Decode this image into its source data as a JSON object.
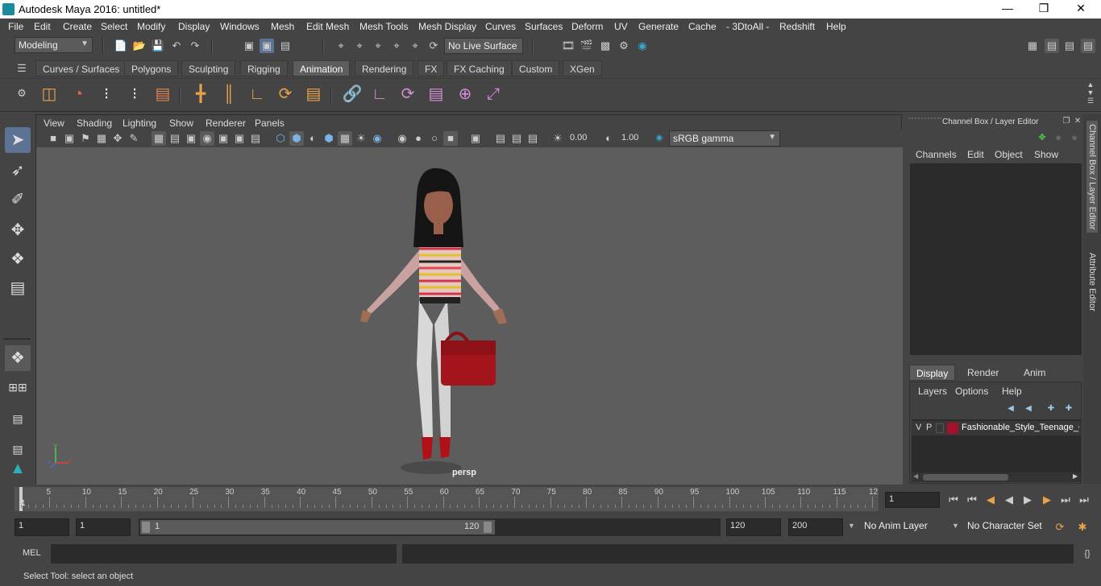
{
  "window": {
    "title": "Autodesk Maya 2016: untitled*"
  },
  "menus": [
    "File",
    "Edit",
    "Create",
    "Select",
    "Modify",
    "Display",
    "Windows",
    "Mesh",
    "Edit Mesh",
    "Mesh Tools",
    "Mesh Display",
    "Curves",
    "Surfaces",
    "Deform",
    "UV",
    "Generate",
    "Cache",
    "- 3DtoAll -",
    "Redshift",
    "Help"
  ],
  "status": {
    "mode": "Modeling",
    "live_surface": "No Live Surface"
  },
  "shelf_tabs": [
    "Curves / Surfaces",
    "Polygons",
    "Sculpting",
    "Rigging",
    "Animation",
    "Rendering",
    "FX",
    "FX Caching",
    "Custom",
    "XGen"
  ],
  "shelf_active": "Animation",
  "viewport": {
    "menus": [
      "View",
      "Shading",
      "Lighting",
      "Show",
      "Renderer",
      "Panels"
    ],
    "exposure": "0.00",
    "gamma": "1.00",
    "color_space": "sRGB gamma",
    "camera_label": "persp",
    "axis_y": "y",
    "axis_x": "x",
    "axis_z": "z"
  },
  "channel_box": {
    "title": "Channel Box / Layer Editor",
    "menus": [
      "Channels",
      "Edit",
      "Object",
      "Show"
    ]
  },
  "layer_editor": {
    "tabs": [
      "Display",
      "Render",
      "Anim"
    ],
    "menus": [
      "Layers",
      "Options",
      "Help"
    ],
    "layer": {
      "v": "V",
      "p": "P",
      "name": "Fashionable_Style_Teenage_Girl",
      "color": "#a3122a"
    }
  },
  "side_tabs": [
    "Channel Box / Layer Editor",
    "Attribute Editor"
  ],
  "timeline": {
    "ticks": [
      "5",
      "10",
      "15",
      "20",
      "25",
      "30",
      "35",
      "40",
      "45",
      "50",
      "55",
      "60",
      "65",
      "70",
      "75",
      "80",
      "85",
      "90",
      "95",
      "100",
      "105",
      "110",
      "115",
      "12"
    ],
    "start_label": "1",
    "current_frame": "1"
  },
  "range": {
    "start": "1",
    "playback_start": "1",
    "slider_start": "1",
    "slider_end": "120",
    "playback_end": "120",
    "end": "200",
    "anim_layer": "No Anim Layer",
    "character_set": "No Character Set"
  },
  "cmdline": {
    "label": "MEL"
  },
  "helpline": {
    "text": "Select Tool: select an object"
  },
  "colors": {
    "accent": "#5c7394",
    "tab_active": "#5d5d5d",
    "bag": "#a3141c"
  }
}
